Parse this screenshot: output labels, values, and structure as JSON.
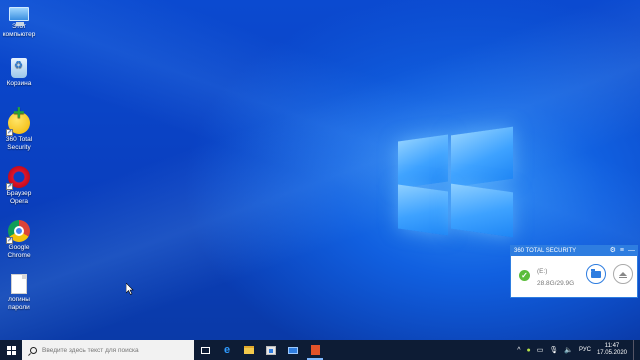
{
  "desktop_icons": [
    {
      "label": "Этот компьютер",
      "icon": "computer-icon"
    },
    {
      "label": "Корзина",
      "icon": "recycle-bin-icon"
    },
    {
      "label": "360 Total Security",
      "icon": "360-total-security-icon"
    },
    {
      "label": "Браузер Opera",
      "icon": "opera-icon"
    },
    {
      "label": "Google Chrome",
      "icon": "chrome-icon"
    },
    {
      "label": "логины пароли",
      "icon": "text-file-icon"
    }
  ],
  "widget": {
    "title": "360 TOTAL SECURITY",
    "settings_glyph": "⚙",
    "menu_glyph": "≡",
    "minimize_glyph": "—",
    "drive_name": "(E:)",
    "drive_size": "28.8G/29.9G",
    "status": "ok"
  },
  "taskbar": {
    "search_placeholder": "Введите здесь текст для поиска",
    "apps": [
      "task-view-icon",
      "edge-icon",
      "explorer-icon",
      "store-icon",
      "mail-icon",
      "office-icon"
    ],
    "tray": {
      "language": "РУС",
      "time": "11:47",
      "date": "17.05.2020",
      "tray_up_glyph": "^",
      "volume_glyph": "🔈",
      "mic_glyph": "🎙",
      "network_glyph": "▭"
    }
  },
  "colors": {
    "desktop": "#0a3fb8",
    "accent": "#2e7de0",
    "taskbar": "#0d1c35",
    "ok_green": "#5bbd3b"
  }
}
